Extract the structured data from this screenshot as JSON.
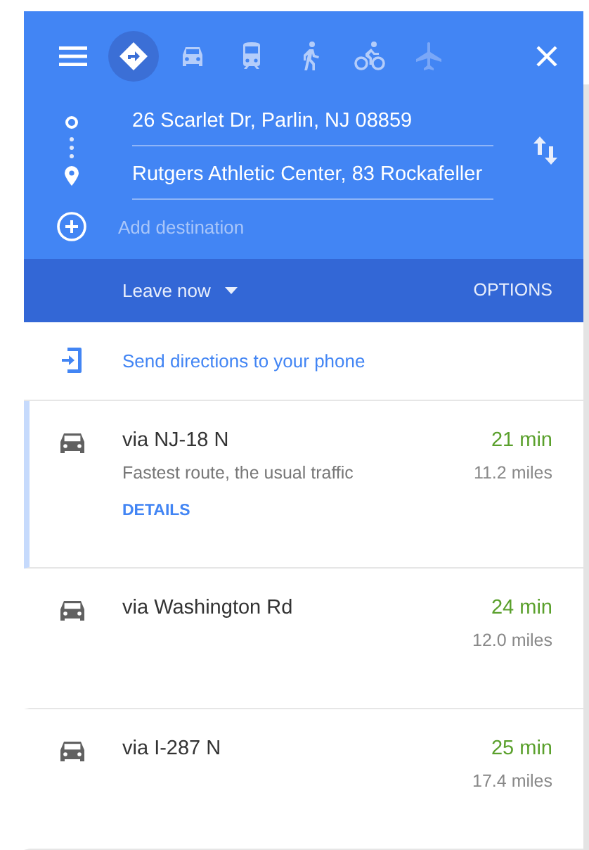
{
  "travel_modes": [
    {
      "kind": "best",
      "selected": true,
      "disabled": false
    },
    {
      "kind": "car",
      "selected": false,
      "disabled": false
    },
    {
      "kind": "transit",
      "selected": false,
      "disabled": false
    },
    {
      "kind": "walk",
      "selected": false,
      "disabled": false
    },
    {
      "kind": "bike",
      "selected": false,
      "disabled": false
    },
    {
      "kind": "flight",
      "selected": false,
      "disabled": true
    }
  ],
  "origin": {
    "value": "26 Scarlet Dr, Parlin, NJ 08859"
  },
  "destination": {
    "value": "Rutgers Athletic Center, 83 Rockafeller"
  },
  "add_destination": {
    "placeholder": "Add destination"
  },
  "leave_option": "Leave now",
  "options_button": "OPTIONS",
  "send_link": "Send directions to your phone",
  "routes": [
    {
      "name": "via NJ-18 N",
      "note": "Fastest route, the usual traffic",
      "time": "21 min",
      "distance": "11.2 miles",
      "details": "DETAILS",
      "selected": true
    },
    {
      "name": "via Washington Rd",
      "time": "24 min",
      "distance": "12.0 miles",
      "selected": false
    },
    {
      "name": "via I-287 N",
      "time": "25 min",
      "distance": "17.4 miles",
      "selected": false
    }
  ]
}
